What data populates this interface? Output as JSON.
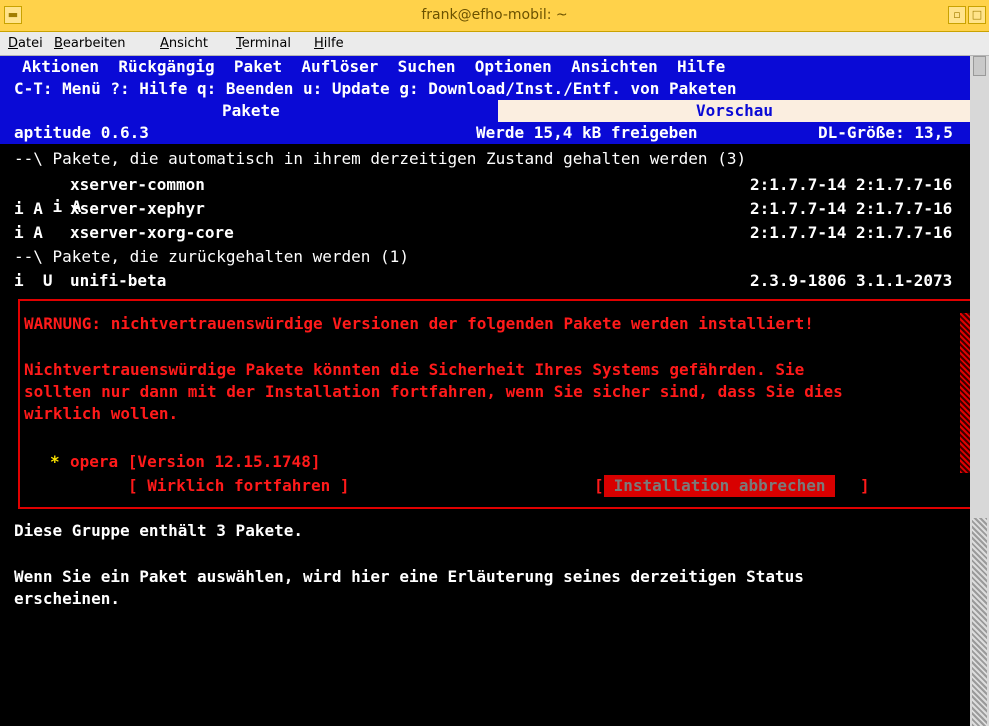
{
  "window": {
    "title": "frank@efho-mobil: ~"
  },
  "menubar": {
    "items": [
      "Datei",
      "Bearbeiten",
      "Ansicht",
      "Terminal",
      "Hilfe"
    ]
  },
  "aptitude": {
    "menu": "Aktionen  Rückgängig  Paket  Auflöser  Suchen  Optionen  Ansichten  Hilfe",
    "help": "C-T: Menü ?: Hilfe q: Beenden u: Update g: Download/Inst./Entf. von Paketen",
    "tab_packages": "Pakete",
    "tab_preview": "Vorschau",
    "status_left": "aptitude 0.6.3",
    "status_mid": "Werde 15,4 kB freigeben",
    "status_right": "DL-Größe: 13,5",
    "group1": "--\\ Pakete, die automatisch in ihrem derzeitigen Zustand gehalten werden (3)",
    "rows1": [
      {
        "flags": "i A",
        "name": "xserver-common",
        "versions": "2:1.7.7-14 2:1.7.7-16"
      },
      {
        "flags": "i A",
        "name": "xserver-xephyr",
        "versions": "2:1.7.7-14 2:1.7.7-16"
      },
      {
        "flags": "i A",
        "name": "xserver-xorg-core",
        "versions": "2:1.7.7-14 2:1.7.7-16"
      }
    ],
    "group2": "--\\ Pakete, die zurückgehalten werden (1)",
    "rows2": [
      {
        "flags": "i  U",
        "name": "unifi-beta",
        "versions": "2.3.9-1806 3.1.1-2073"
      }
    ]
  },
  "dialog": {
    "warning": "WARNUNG: nichtvertrauenswürdige Versionen der folgenden Pakete werden installiert!",
    "line1": "Nichtvertrauenswürdige Pakete könnten die Sicherheit Ihres Systems gefährden. Sie",
    "line2": "sollten nur dann mit der Installation fortfahren, wenn Sie sicher sind, dass Sie dies",
    "line3": "wirklich wollen.",
    "bullet": "*",
    "package": "opera [Version 12.15.1748]",
    "continue_label": "[ Wirklich fortfahren ]",
    "cancel_open": "[",
    "cancel_label": " Installation abbrechen ",
    "cancel_close": "]"
  },
  "info": {
    "line1": "Diese Gruppe enthält 3 Pakete.",
    "line2": "Wenn Sie ein Paket auswählen, wird hier eine Erläuterung seines derzeitigen Status",
    "line3": "erscheinen."
  }
}
